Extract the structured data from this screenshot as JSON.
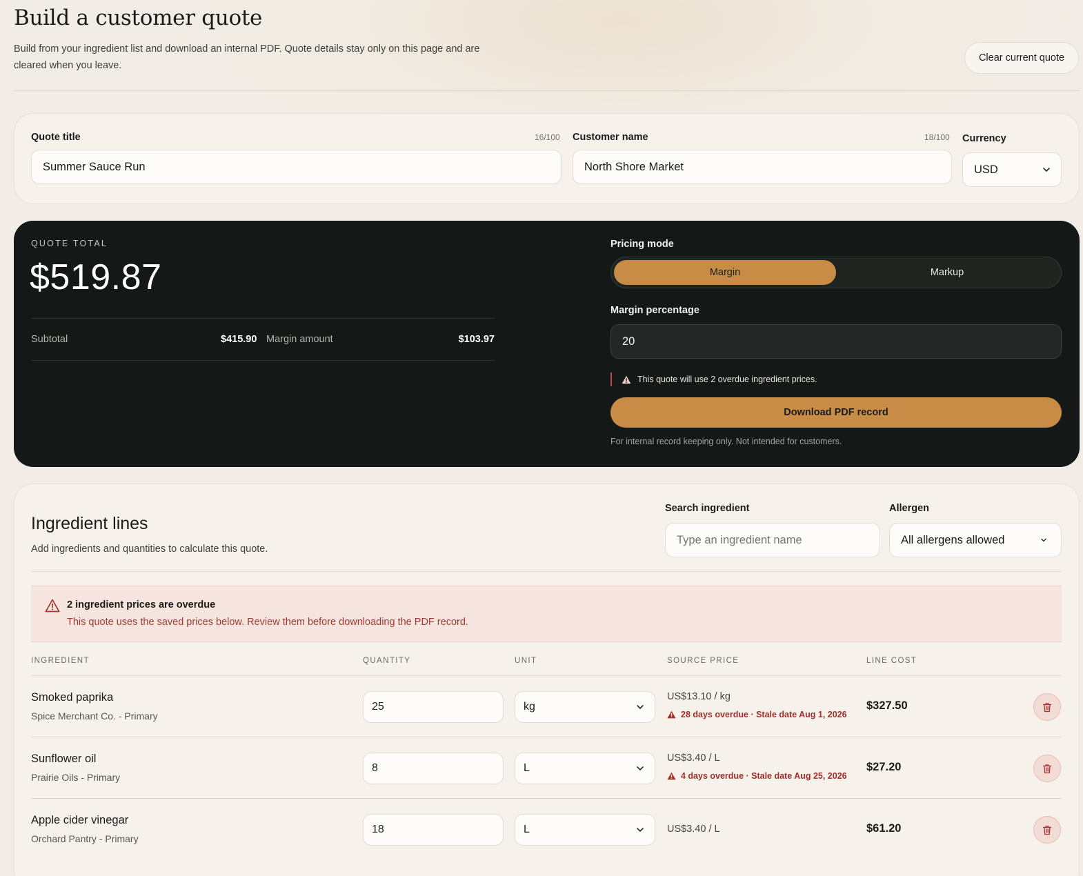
{
  "header": {
    "title": "Build a customer quote",
    "description": "Build from your ingredient list and download an internal PDF. Quote details stay only on this page and are cleared when you leave.",
    "clear_label": "Clear current quote"
  },
  "details": {
    "quote_title_label": "Quote title",
    "quote_title_count": "16/100",
    "quote_title_value": "Summer Sauce Run",
    "customer_label": "Customer name",
    "customer_count": "18/100",
    "customer_value": "North Shore Market",
    "currency_label": "Currency",
    "currency_value": "USD"
  },
  "total": {
    "label": "QUOTE TOTAL",
    "amount": "$519.87",
    "subtotal_label": "Subtotal",
    "subtotal_value": "$415.90",
    "margin_amount_label": "Margin amount",
    "margin_amount_value": "$103.97"
  },
  "pricing": {
    "mode_label": "Pricing mode",
    "options": [
      "Margin",
      "Markup"
    ],
    "selected": "Margin",
    "percentage_label": "Margin percentage",
    "percentage_value": "20",
    "warning": "This quote will use 2 overdue ingredient prices.",
    "download_label": "Download PDF record",
    "note": "For internal record keeping only. Not intended for customers."
  },
  "lines": {
    "title": "Ingredient lines",
    "subtitle": "Add ingredients and quantities to calculate this quote.",
    "search_label": "Search ingredient",
    "search_placeholder": "Type an ingredient name",
    "allergen_label": "Allergen",
    "allergen_value": "All allergens allowed",
    "alert_title": "2 ingredient prices are overdue",
    "alert_text": "This quote uses the saved prices below. Review them before downloading the PDF record.",
    "columns": [
      "INGREDIENT",
      "QUANTITY",
      "UNIT",
      "SOURCE PRICE",
      "LINE COST"
    ],
    "rows": [
      {
        "name": "Smoked paprika",
        "source": "Spice Merchant Co. - Primary",
        "quantity": "25",
        "unit": "kg",
        "price": "US$13.10 / kg",
        "overdue": "28 days overdue · Stale date Aug 1, 2026",
        "cost": "$327.50"
      },
      {
        "name": "Sunflower oil",
        "source": "Prairie Oils - Primary",
        "quantity": "8",
        "unit": "L",
        "price": "US$3.40 / L",
        "overdue": "4 days overdue · Stale date Aug 25, 2026",
        "cost": "$27.20"
      },
      {
        "name": "Apple cider vinegar",
        "source": "Orchard Pantry - Primary",
        "quantity": "18",
        "unit": "L",
        "price": "US$3.40 / L",
        "overdue": "",
        "cost": "$61.20"
      }
    ]
  },
  "colors": {
    "accent": "#c88c47",
    "dark_panel": "#141816",
    "alert_bg": "#f6e4de",
    "alert_text": "#9e3a34"
  }
}
